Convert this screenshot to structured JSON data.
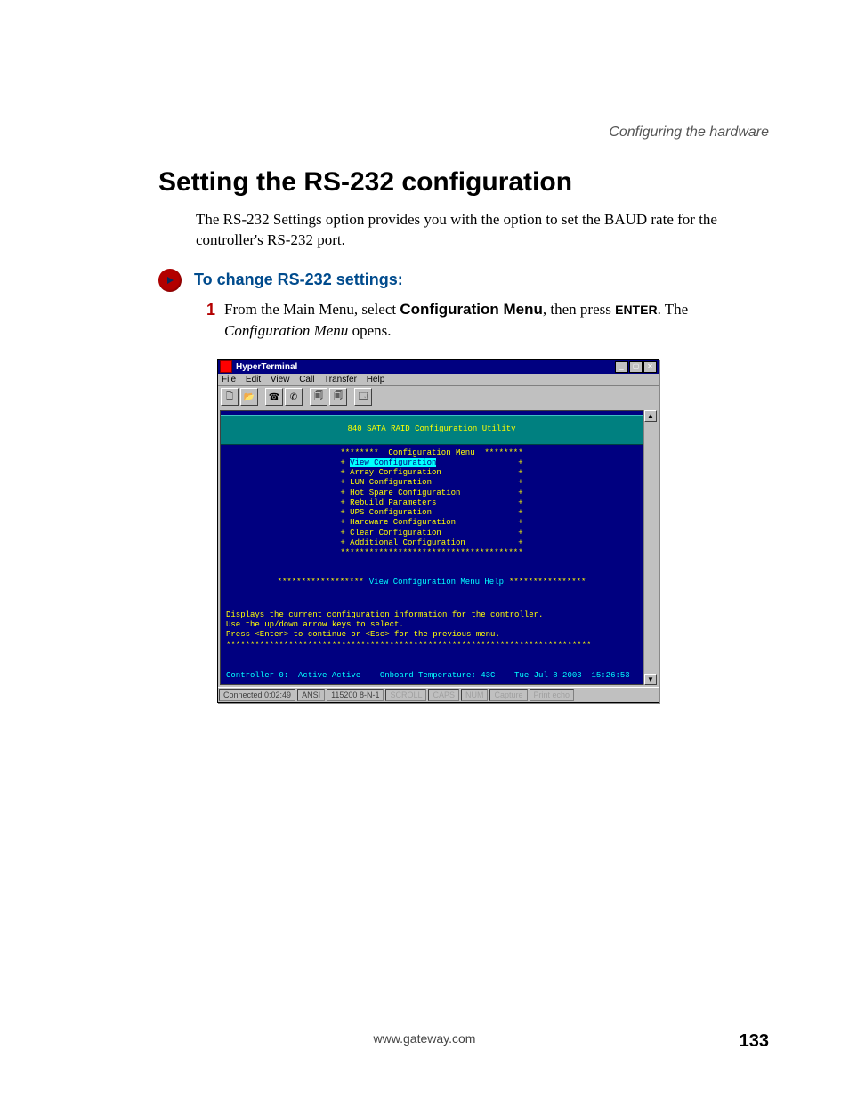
{
  "header": {
    "running": "Configuring the hardware"
  },
  "title": "Setting the RS-232 configuration",
  "intro": "The RS-232 Settings option provides you with the option to set the BAUD rate for the controller's RS-232 port.",
  "procedure": {
    "title": "To change RS-232 settings:"
  },
  "step": {
    "num": "1",
    "t1": "From the Main Menu, select ",
    "bold1": "Configuration Menu",
    "t2": ", then press ",
    "caps1": "ENTER",
    "t3": ". The ",
    "ital1": "Configuration Menu",
    "t4": " opens."
  },
  "win": {
    "title": "HyperTerminal",
    "menu": [
      "File",
      "Edit",
      "View",
      "Call",
      "Transfer",
      "Help"
    ],
    "banner": "840 SATA RAID Configuration Utility",
    "menu_header": "********  Configuration Menu  ********",
    "menu_items": [
      "View Configuration",
      "Array Configuration",
      "LUN Configuration",
      "Hot Spare Configuration",
      "Rebuild Parameters",
      "UPS Configuration",
      "Hardware Configuration",
      "Clear Configuration",
      "Additional Configuration"
    ],
    "menu_footer": "**************************************",
    "help_stars": "******************",
    "help_title": "View Configuration Menu Help",
    "help_stars2": "****************",
    "help_lines": [
      "Displays the current configuration information for the controller.",
      "Use the up/down arrow keys to select.",
      "Press <Enter> to continue or <Esc> for the previous menu.",
      "****************************************************************************"
    ],
    "status_term": "Controller 0:  Active Active    Onboard Temperature: 43C    Tue Jul 8 2003  15:26:53",
    "statusbar": {
      "connected": "Connected 0:02:49",
      "emul": "ANSI",
      "line": "115200 8-N-1",
      "cells": [
        "SCROLL",
        "CAPS",
        "NUM",
        "Capture",
        "Print echo"
      ]
    }
  },
  "footer": {
    "url": "www.gateway.com",
    "page": "133"
  }
}
